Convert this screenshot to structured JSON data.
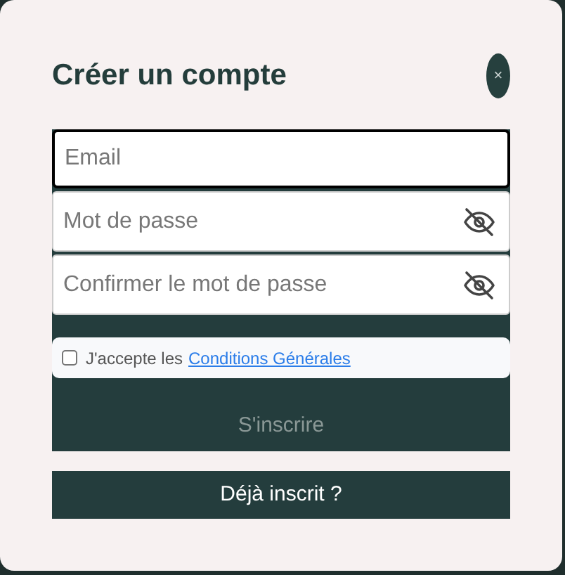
{
  "dialog": {
    "title": "Créer un compte",
    "close": "×"
  },
  "fields": [
    {
      "kind": "email",
      "placeholder": "Email",
      "focused": true
    },
    {
      "kind": "password",
      "placeholder": "Mot de passe",
      "focused": false
    },
    {
      "kind": "password",
      "placeholder": "Confirmer le mot de passe",
      "focused": false
    }
  ],
  "terms": {
    "checked": false,
    "text": "J'accepte les",
    "link": "Conditions Générales"
  },
  "submit": {
    "label": "S'inscrire",
    "disabled": true
  },
  "login": {
    "label": "Déjà inscrit ?"
  }
}
